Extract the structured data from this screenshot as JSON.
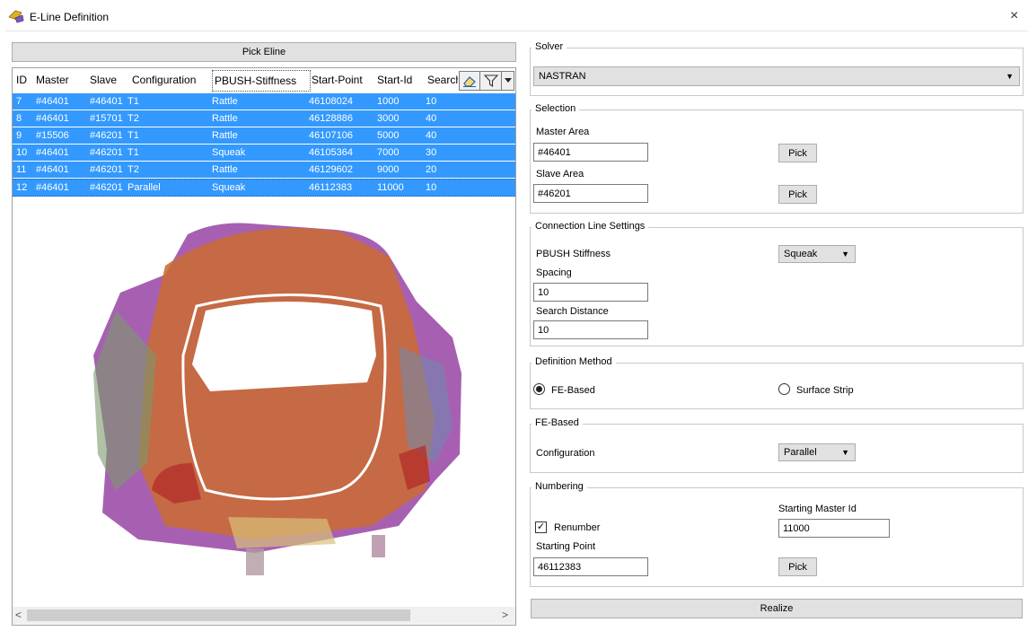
{
  "window": {
    "title": "E-Line Definition",
    "close_glyph": "×"
  },
  "left": {
    "pick_eline_label": "Pick Eline",
    "table": {
      "columns": [
        "ID",
        "Master",
        "Slave",
        "Configuration",
        "PBUSH-Stiffness",
        "Start-Point",
        "Start-Id",
        "Search"
      ],
      "rows": [
        [
          "7",
          "#46401",
          "#46401",
          "T1",
          "Rattle",
          "46108024",
          "1000",
          "10"
        ],
        [
          "8",
          "#46401",
          "#15701",
          "T2",
          "Rattle",
          "46128886",
          "3000",
          "40"
        ],
        [
          "9",
          "#15506",
          "#46201",
          "T1",
          "Rattle",
          "46107106",
          "5000",
          "40"
        ],
        [
          "10",
          "#46401",
          "#46201",
          "T1",
          "Squeak",
          "46105364",
          "7000",
          "30"
        ],
        [
          "11",
          "#46401",
          "#46201",
          "T2",
          "Rattle",
          "46129602",
          "9000",
          "20"
        ],
        [
          "12",
          "#46401",
          "#46201",
          "Parallel",
          "Squeak",
          "46112383",
          "11000",
          "10"
        ]
      ]
    },
    "icons": {
      "clear": "eraser-icon",
      "filter": "filter-icon",
      "dropdown": "chevron-down-icon"
    }
  },
  "solver": {
    "title": "Solver",
    "value": "NASTRAN"
  },
  "selection": {
    "title": "Selection",
    "master_label": "Master Area",
    "master_value": "#46401",
    "master_pick": "Pick",
    "slave_label": "Slave Area",
    "slave_value": "#46201",
    "slave_pick": "Pick"
  },
  "connection": {
    "title": "Connection Line Settings",
    "pbush_label": "PBUSH Stiffness",
    "pbush_value": "Squeak",
    "spacing_label": "Spacing",
    "spacing_value": "10",
    "search_label": "Search Distance",
    "search_value": "10"
  },
  "definition": {
    "title": "Definition Method",
    "option_fe": "FE-Based",
    "option_strip": "Surface Strip",
    "selected": "FE-Based"
  },
  "fe_based": {
    "title": "FE-Based",
    "config_label": "Configuration",
    "config_value": "Parallel"
  },
  "numbering": {
    "title": "Numbering",
    "renumber_label": "Renumber",
    "renumber_checked": true,
    "check_glyph": "✓",
    "master_id_label": "Starting Master Id",
    "master_id_value": "11000",
    "start_point_label": "Starting Point",
    "start_point_value": "46112383",
    "pick_label": "Pick"
  },
  "realize_label": "Realize",
  "colors": {
    "selection": "#3399ff",
    "button": "#e1e1e1",
    "border": "#adadad"
  }
}
